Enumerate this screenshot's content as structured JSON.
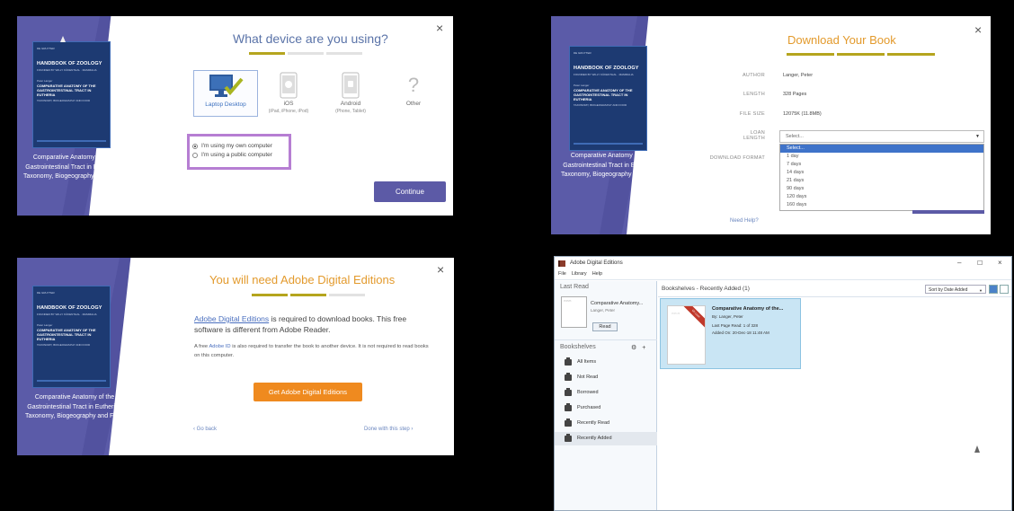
{
  "book": {
    "cover_publisher": "DE GRUYTER",
    "cover_series": "HANDBOOK OF ZOOLOGY",
    "cover_volume": "FOUNDED BY WILLY KÜKENTHAL · MAMMALIA",
    "cover_author": "Peter Langer",
    "cover_title": "COMPARATIVE ANATOMY OF THE GASTROINTESTINAL TRACT IN EUTHERIA",
    "cover_subtitle": "TAXONOMY, BIOGEOGRAPHY AND FOOD",
    "side_title": "Comparative Anatomy of the Gastrointestinal Tract in Eutheria : Taxonomy, Biogeography and Food"
  },
  "device_dialog": {
    "heading": "What device are you using?",
    "devices": [
      {
        "label": "Laptop Desktop",
        "sub": "",
        "icon": "monitor-check-icon",
        "selected": true
      },
      {
        "label": "iOS",
        "sub": "(iPad, iPhone, iPod)",
        "icon": "apple-icon",
        "selected": false
      },
      {
        "label": "Android",
        "sub": "(Phone, Tablet)",
        "icon": "android-icon",
        "selected": false
      },
      {
        "label": "Other",
        "sub": "",
        "icon": "question-icon",
        "selected": false
      }
    ],
    "radio_own": "I'm using my own computer",
    "radio_public": "I'm using a public computer",
    "continue_label": "Continue",
    "close_label": "×"
  },
  "download_dialog": {
    "heading": "Download Your Book",
    "author_label": "AUTHOR",
    "author_value": "Langer, Peter",
    "length_label": "LENGTH",
    "length_value": "328 Pages",
    "filesize_label": "FILE SIZE",
    "filesize_value": "12075K (11.8MB)",
    "loan_label": "LOAN LENGTH",
    "format_label": "DOWNLOAD FORMAT",
    "select_value": "Select...",
    "options": [
      "Select...",
      "1 day",
      "7 days",
      "14 days",
      "21 days",
      "90 days",
      "120 days",
      "160 days"
    ],
    "need_help": "Need Help?",
    "close_label": "×"
  },
  "adobe_dialog": {
    "heading": "You will need Adobe Digital Editions",
    "body_link": "Adobe Digital Editions",
    "body_text": " is required to download books. This free software is different from Adobe Reader.",
    "note_pre": "A free ",
    "note_link": "Adobe ID",
    "note_post": " is also required to transfer the book to another device. It is not required to read books on this computer.",
    "button_label": "Get Adobe Digital Editions",
    "go_back": "‹ Go back",
    "done": "Done with this step ›",
    "close_label": "×"
  },
  "ade_app": {
    "window_title": "Adobe Digital Editions",
    "menu": [
      "File",
      "Library",
      "Help"
    ],
    "last_read_header": "Last Read",
    "last_read_title": "Comparative Anatomy...",
    "last_read_author": "Langer, Peter",
    "read_button": "Read",
    "bookshelves_header": "Bookshelves",
    "shelves": [
      "All Items",
      "Not Read",
      "Borrowed",
      "Purchased",
      "Recently Read",
      "Recently Added"
    ],
    "active_shelf": "Recently Added",
    "main_title": "Bookshelves - Recently Added (1)",
    "sort_label": "Sort by Date Added",
    "card_title": "Comparative Anatomy of the...",
    "card_author": "By: Langer, Peter",
    "card_last_page": "Last Page Read: 1 of 328",
    "card_added": "Added On: 20-Dec-18 11:48 AM",
    "ribbon_text": "On Loan",
    "win_min": "–",
    "win_max": "☐",
    "win_close": "×"
  },
  "colors": {
    "side_purple": "#5b5ba8",
    "accent_olive": "#b5a51e",
    "orange": "#e39a2c",
    "button_purple": "#5c5aa6",
    "radio_highlight": "#b67ed3"
  }
}
